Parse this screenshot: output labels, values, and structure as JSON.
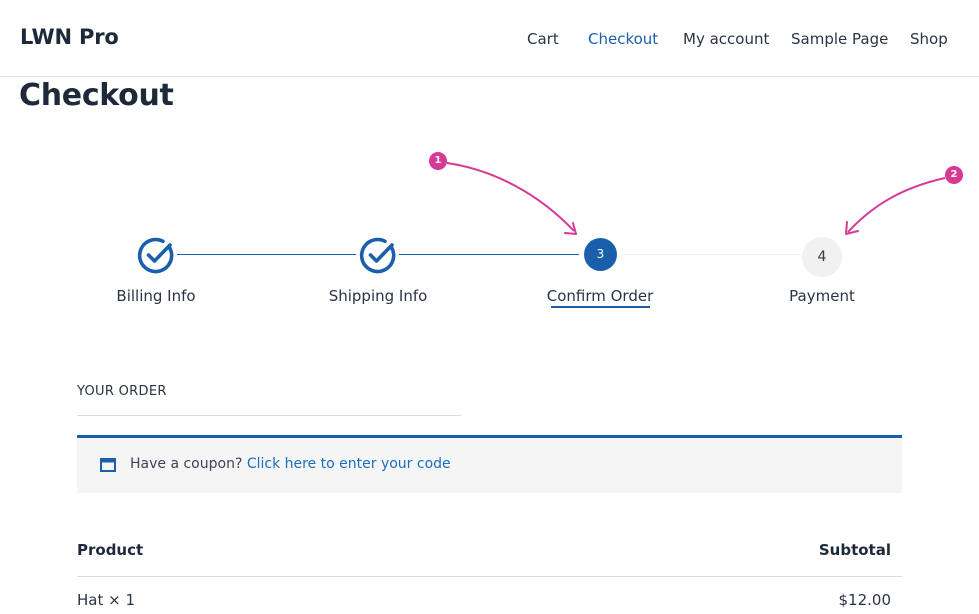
{
  "header": {
    "site_title": "LWN Pro",
    "nav": [
      {
        "label": "Cart",
        "active": false
      },
      {
        "label": "Checkout",
        "active": true
      },
      {
        "label": "My account",
        "active": false
      },
      {
        "label": "Sample Page",
        "active": false
      },
      {
        "label": "Shop",
        "active": false
      }
    ]
  },
  "page_title": "Checkout",
  "steps": [
    {
      "label": "Billing Info",
      "state": "completed",
      "icon": "check-circle-icon"
    },
    {
      "label": "Shipping Info",
      "state": "completed",
      "icon": "check-circle-icon"
    },
    {
      "label": "Confirm Order",
      "number": "3",
      "state": "current"
    },
    {
      "label": "Payment",
      "number": "4",
      "state": "upcoming"
    }
  ],
  "annotations": [
    {
      "number": "1"
    },
    {
      "number": "2"
    }
  ],
  "order": {
    "heading": "YOUR ORDER",
    "coupon_prompt": "Have a coupon?",
    "coupon_link": "Click here to enter your code",
    "coupon_icon": "coupon-icon",
    "columns": [
      "Product",
      "Subtotal"
    ],
    "rows": [
      {
        "product": "Hat × 1",
        "subtotal": "$12.00"
      }
    ]
  },
  "colors": {
    "accent": "#1a5fab",
    "link": "#1a6fc0",
    "annotation": "#d63a95",
    "coupon_bg": "#f5f5f5",
    "upcoming_step": "#f1f1f1"
  }
}
